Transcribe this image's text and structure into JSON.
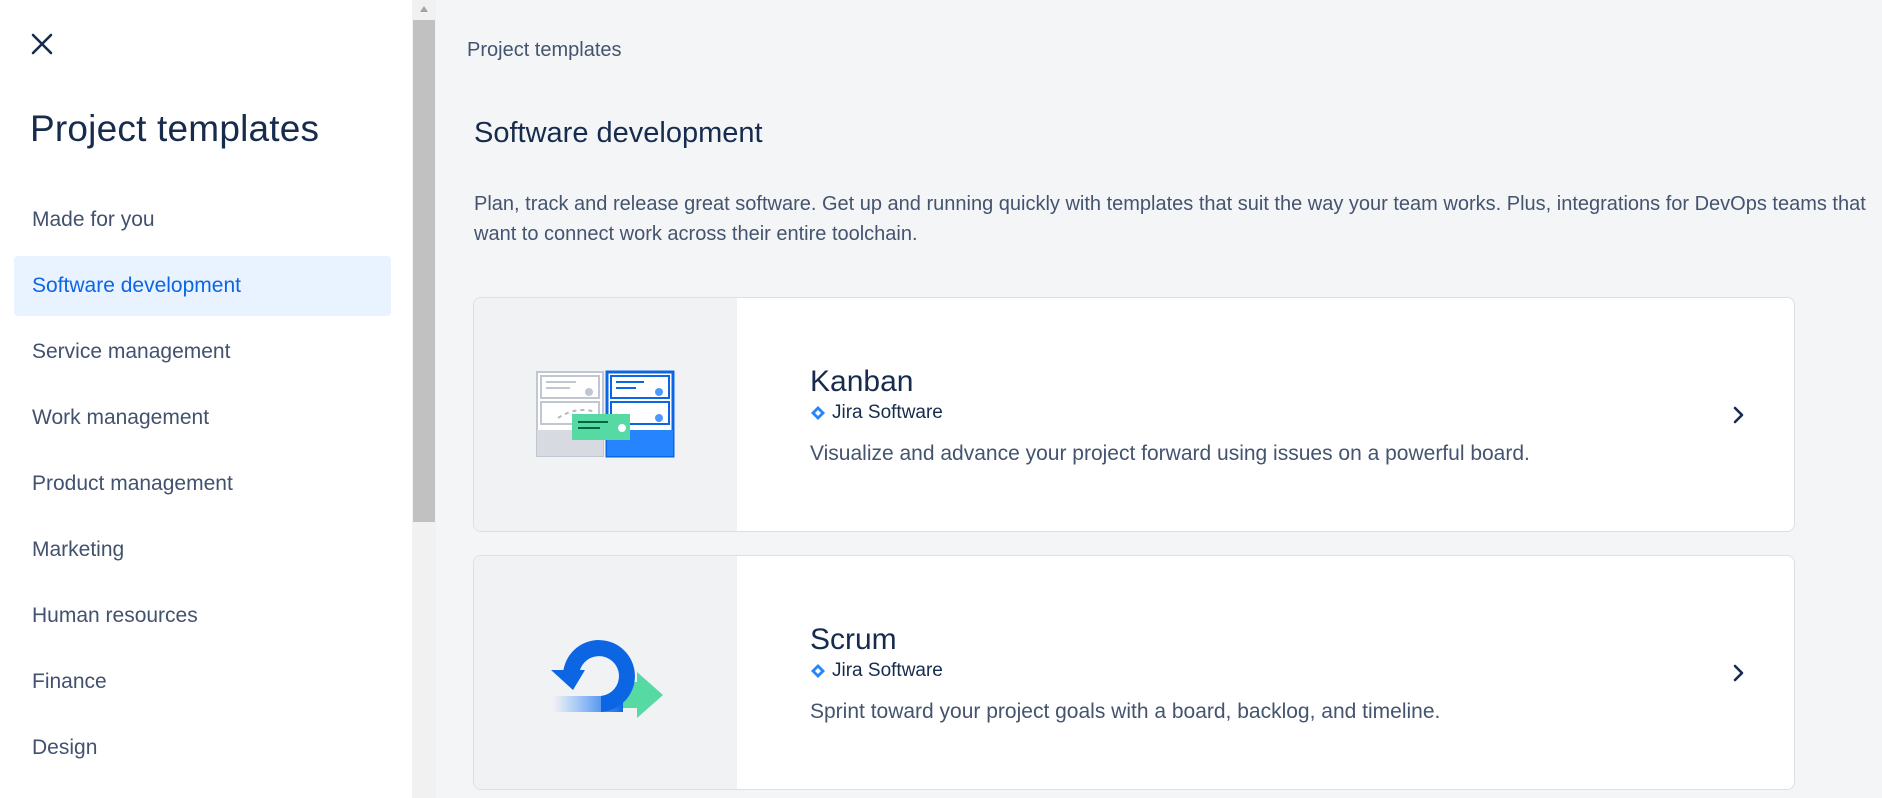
{
  "sidebar": {
    "title": "Project templates",
    "close_icon": "close-icon",
    "items": [
      {
        "label": "Made for you",
        "active": false
      },
      {
        "label": "Software development",
        "active": true
      },
      {
        "label": "Service management",
        "active": false
      },
      {
        "label": "Work management",
        "active": false
      },
      {
        "label": "Product management",
        "active": false
      },
      {
        "label": "Marketing",
        "active": false
      },
      {
        "label": "Human resources",
        "active": false
      },
      {
        "label": "Finance",
        "active": false
      },
      {
        "label": "Design",
        "active": false
      }
    ]
  },
  "main": {
    "breadcrumb": "Project templates",
    "section_title": "Software development",
    "section_desc": "Plan, track and release great software. Get up and running quickly with templates that suit the way your team works. Plus, integrations for DevOps teams that want to connect work across their entire toolchain.",
    "cards": [
      {
        "title": "Kanban",
        "product": "Jira Software",
        "desc": "Visualize and advance your project forward using issues on a powerful board.",
        "illustration": "kanban-board-illustration"
      },
      {
        "title": "Scrum",
        "product": "Jira Software",
        "desc": "Sprint toward your project goals with a board, backlog, and timeline.",
        "illustration": "scrum-cycle-illustration"
      }
    ]
  },
  "colors": {
    "accent": "#0c66e4",
    "active_bg": "#e9f2ff",
    "jira_blue": "#2684ff",
    "green": "#57d9a3"
  }
}
